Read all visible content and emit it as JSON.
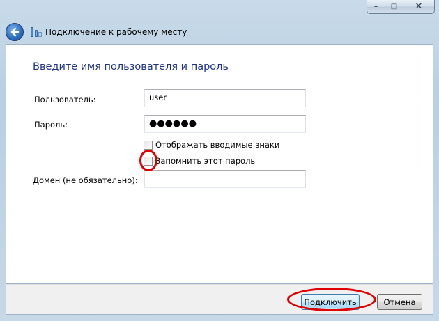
{
  "window": {
    "title": "Подключение к рабочему месту",
    "caption_buttons": {
      "minimize": "–",
      "maximize": "□",
      "close": "✕"
    }
  },
  "form": {
    "heading": "Введите имя пользователя и пароль",
    "user_label": "Пользователь:",
    "user_value": "user",
    "password_label": "Пароль:",
    "password_value": "●●●●●●",
    "show_chars_label": "Отображать вводимые знаки",
    "show_chars_checked": false,
    "remember_label": "Запомнить этот пароль",
    "remember_checked": false,
    "domain_label": "Домен (не обязательно):",
    "domain_value": ""
  },
  "buttons": {
    "connect": "Подключить",
    "cancel": "Отмена"
  },
  "annotations": {
    "color": "#e00000"
  },
  "icons": {
    "back": "back-arrow-icon",
    "network": "network-connection-icon"
  }
}
